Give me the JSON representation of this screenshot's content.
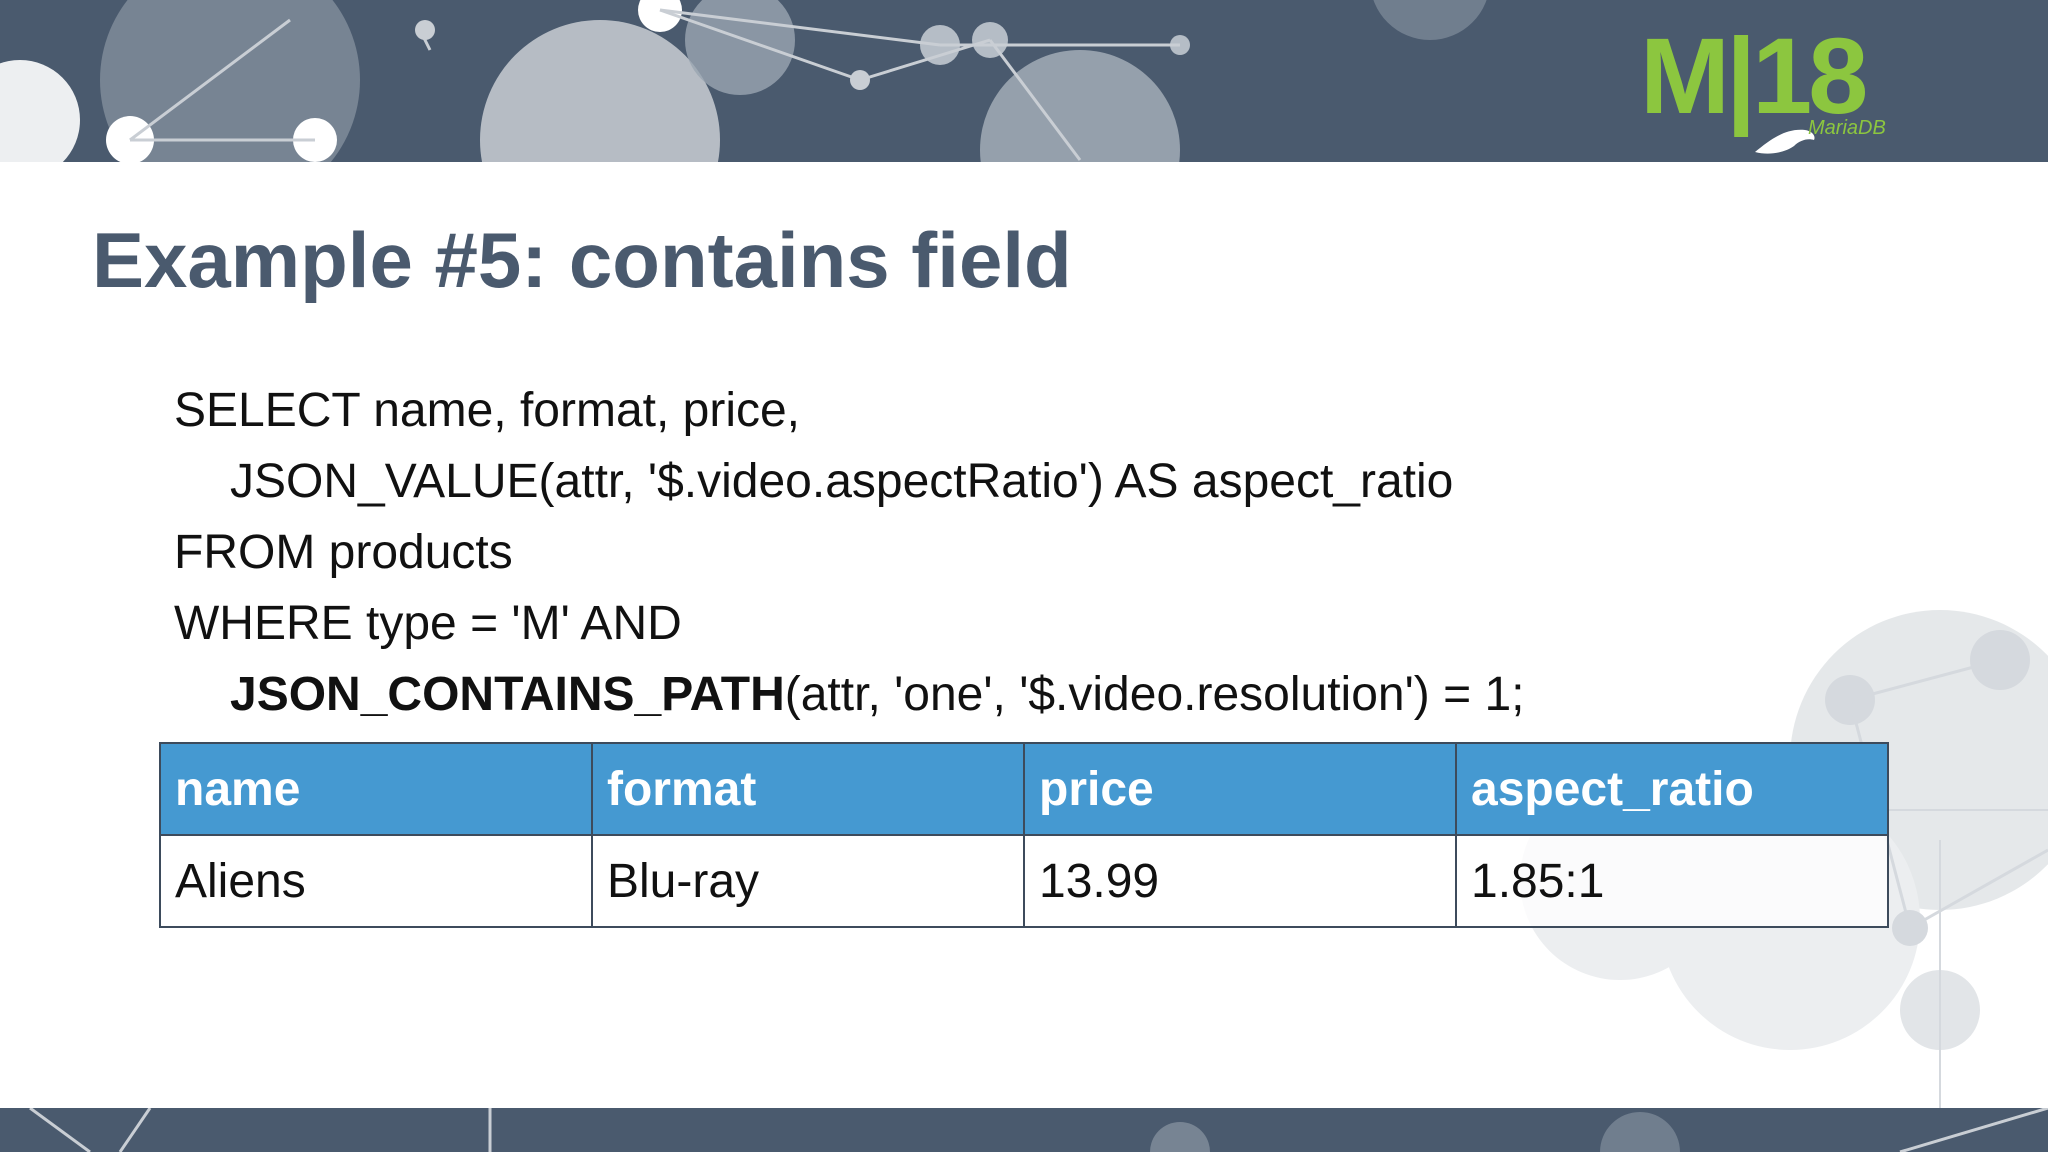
{
  "slide": {
    "title": "Example #5: contains field",
    "logo": {
      "text": "M|18",
      "sub": "MariaDB"
    },
    "code_lines": [
      "SELECT name, format, price,",
      "JSON_VALUE(attr, '$.video.aspectRatio') AS aspect_ratio",
      "FROM products",
      "WHERE type = 'M' AND",
      {
        "bold": "JSON_CONTAINS_PATH",
        "rest": "(attr, 'one', '$.video.resolution') = 1;"
      }
    ],
    "table": {
      "headers": [
        "name",
        "format",
        "price",
        "aspect_ratio"
      ],
      "rows": [
        [
          "Aliens",
          "Blu-ray",
          "13.99",
          "1.85:1"
        ]
      ]
    }
  },
  "colors": {
    "band": "#4a5a6e",
    "title": "#4a5a6e",
    "header_fill": "#4599d1",
    "logo": "#8cc63f"
  }
}
